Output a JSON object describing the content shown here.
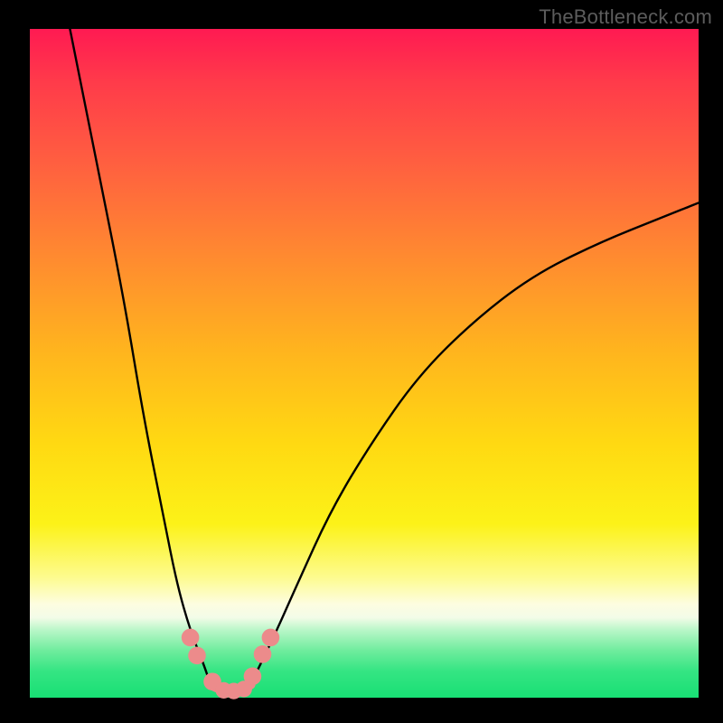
{
  "watermark": "TheBottleneck.com",
  "chart_data": {
    "type": "line",
    "title": "",
    "xlabel": "",
    "ylabel": "",
    "xlim": [
      0,
      100
    ],
    "ylim": [
      0,
      100
    ],
    "grid": false,
    "legend": false,
    "series": [
      {
        "name": "left-branch",
        "color": "#000000",
        "x": [
          6,
          10,
          14,
          17,
          20,
          22,
          24,
          26,
          27
        ],
        "y": [
          100,
          80,
          60,
          42,
          27,
          17,
          10,
          5,
          2
        ]
      },
      {
        "name": "right-branch",
        "color": "#000000",
        "x": [
          33,
          36,
          40,
          45,
          51,
          58,
          66,
          75,
          85,
          95,
          100
        ],
        "y": [
          2,
          8,
          17,
          28,
          38,
          48,
          56,
          63,
          68,
          72,
          74
        ]
      },
      {
        "name": "valley-floor",
        "color": "#ec8b8b",
        "x": [
          27,
          28.5,
          30,
          31.5,
          33
        ],
        "y": [
          2,
          1.2,
          1,
          1.2,
          2
        ]
      }
    ],
    "markers": [
      {
        "name": "left-upper-dot",
        "x": 24,
        "y": 9,
        "r": 1.4,
        "color": "#ec8b8b"
      },
      {
        "name": "left-lower-dot",
        "x": 25,
        "y": 6.3,
        "r": 1.4,
        "color": "#ec8b8b"
      },
      {
        "name": "left-floor-dot",
        "x": 27.3,
        "y": 2.4,
        "r": 1.4,
        "color": "#ec8b8b"
      },
      {
        "name": "floor-dot-1",
        "x": 29,
        "y": 1.1,
        "r": 1.3,
        "color": "#ec8b8b"
      },
      {
        "name": "floor-dot-2",
        "x": 30.5,
        "y": 1.0,
        "r": 1.3,
        "color": "#ec8b8b"
      },
      {
        "name": "floor-dot-3",
        "x": 32,
        "y": 1.3,
        "r": 1.3,
        "color": "#ec8b8b"
      },
      {
        "name": "right-lower-dot",
        "x": 33.3,
        "y": 3.2,
        "r": 1.4,
        "color": "#ec8b8b"
      },
      {
        "name": "right-upper-dot",
        "x": 34.8,
        "y": 6.5,
        "r": 1.4,
        "color": "#ec8b8b"
      },
      {
        "name": "right-top-dot",
        "x": 36,
        "y": 9,
        "r": 1.4,
        "color": "#ec8b8b"
      }
    ],
    "notes": "V-shaped bottleneck curve on a red→green vertical gradient. Valley bottom around x≈30 at y≈1. Left branch reaches y=100 near x≈6; right branch rises toward y≈74 at x=100. Salmon-colored floor segment and marker dots near the trough."
  }
}
